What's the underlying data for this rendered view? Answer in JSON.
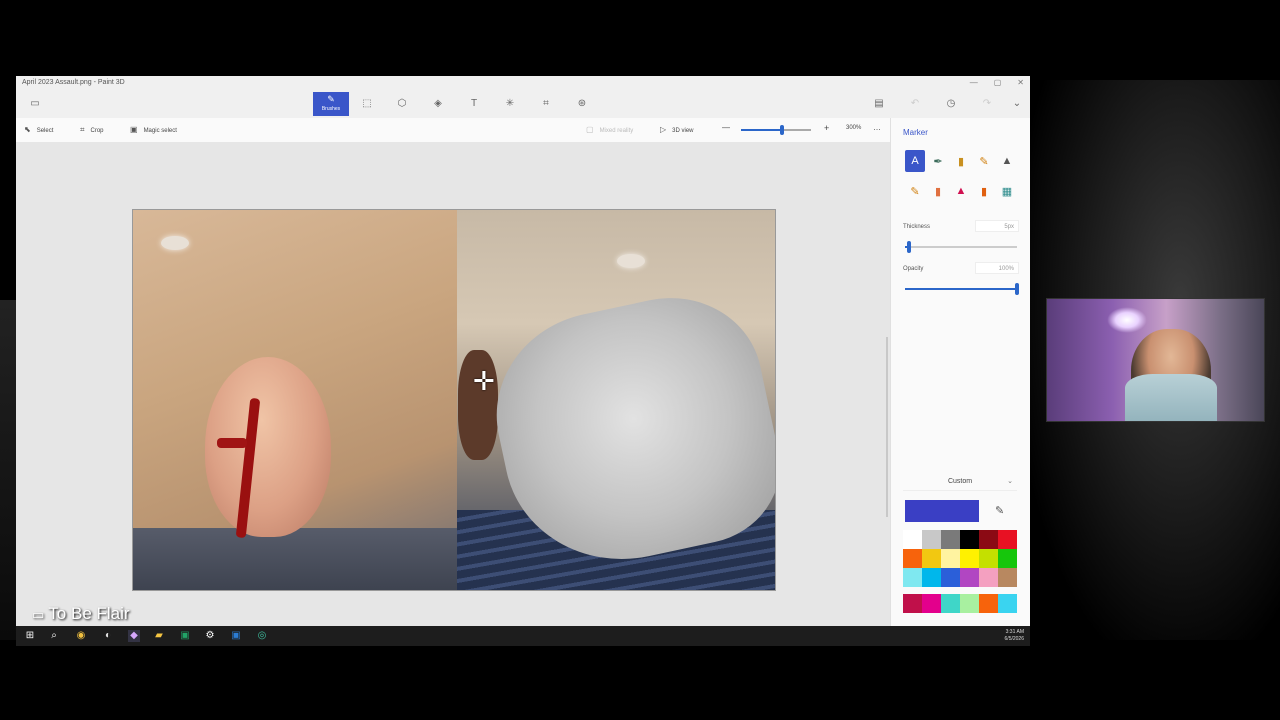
{
  "window": {
    "title": "April 2023 Assault.png - Paint 3D",
    "controls": [
      "—",
      "▢",
      "✕"
    ]
  },
  "toolbar": {
    "menu_icon": "menu-icon",
    "tabs": [
      {
        "name": "brushes",
        "label": "Brushes",
        "icon": "✎"
      },
      {
        "name": "2d-shapes",
        "icon": "⬚"
      },
      {
        "name": "3d-shapes",
        "icon": "⬡"
      },
      {
        "name": "stickers",
        "icon": "◈"
      },
      {
        "name": "text",
        "icon": "T"
      },
      {
        "name": "effects",
        "icon": "✳"
      },
      {
        "name": "canvas",
        "icon": "⌗"
      },
      {
        "name": "3d-library",
        "icon": "⊛"
      }
    ],
    "right_icons": [
      "paste-icon",
      "undo-icon",
      "history-icon",
      "redo-icon",
      "expand-icon"
    ]
  },
  "subbar": {
    "select_label": "Select",
    "crop_label": "Crop",
    "magic_select_label": "Magic select",
    "mixed_reality_label": "Mixed reality",
    "view3d_label": "3D view",
    "zoom_minus": "—",
    "zoom_plus": "+",
    "zoom_level": "300%",
    "zoom_fraction": 0.58,
    "more": "…"
  },
  "panel": {
    "title": "Marker",
    "brushes_row1": [
      "A",
      "✒",
      "▮",
      "✎",
      "▲"
    ],
    "brushes_row2": [
      "✎",
      "▮",
      "▲",
      "▮",
      "▦"
    ],
    "thickness_label": "Thickness",
    "thickness_value": "5px",
    "thickness_fraction": 0.04,
    "opacity_label": "Opacity",
    "opacity_value": "100%",
    "opacity_fraction": 1.0,
    "custom_label": "Custom",
    "selected_color": "#3a3fc4",
    "palette": [
      "#ffffff",
      "#c8c8c8",
      "#7a7a7a",
      "#000000",
      "#8b0a14",
      "#e81123",
      "#f7630c",
      "#f2c811",
      "#fff3a0",
      "#fff100",
      "#c4e000",
      "#16c60c",
      "#7fe8f0",
      "#00b7eb",
      "#2b5fd9",
      "#b146c2",
      "#f4a0c0",
      "#b88860"
    ],
    "custom_palette": [
      "#c0104a",
      "#e3008c",
      "#3fd6c8",
      "#a8f0a0",
      "#f7630c",
      "#3ad4f0"
    ]
  },
  "taskbar": {
    "icons": [
      "windows-icon",
      "search-icon",
      "chrome-icon",
      "app-icon",
      "paint3d-icon",
      "folder-icon",
      "excel-icon",
      "settings-icon",
      "word-icon",
      "edge-icon"
    ],
    "time": "3:31 AM",
    "date": "6/5/2026"
  },
  "overlay": {
    "watermark": "To Be Flair"
  }
}
